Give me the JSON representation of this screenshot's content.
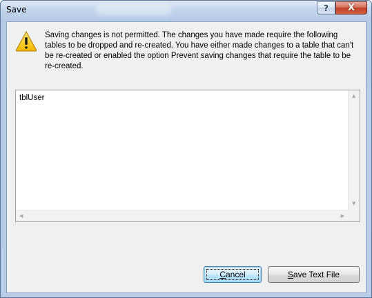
{
  "window": {
    "title": "Save",
    "help_label": "?",
    "close_label": "X"
  },
  "message": {
    "icon": "warning-icon",
    "text": "Saving changes is not permitted. The changes you have made require the following tables to be dropped and re-created. You have either made changes to a table that can't be re-created or enabled the option Prevent saving changes that require the table to be re-created."
  },
  "list": {
    "items": [
      "tblUser"
    ]
  },
  "buttons": {
    "cancel": {
      "mnemonic": "C",
      "rest": "ancel"
    },
    "save_text_file": {
      "mnemonic": "S",
      "rest": "ave Text File"
    }
  },
  "colors": {
    "accent": "#3c7fb1",
    "close_red": "#c2422a",
    "warning_yellow": "#f5c400"
  }
}
